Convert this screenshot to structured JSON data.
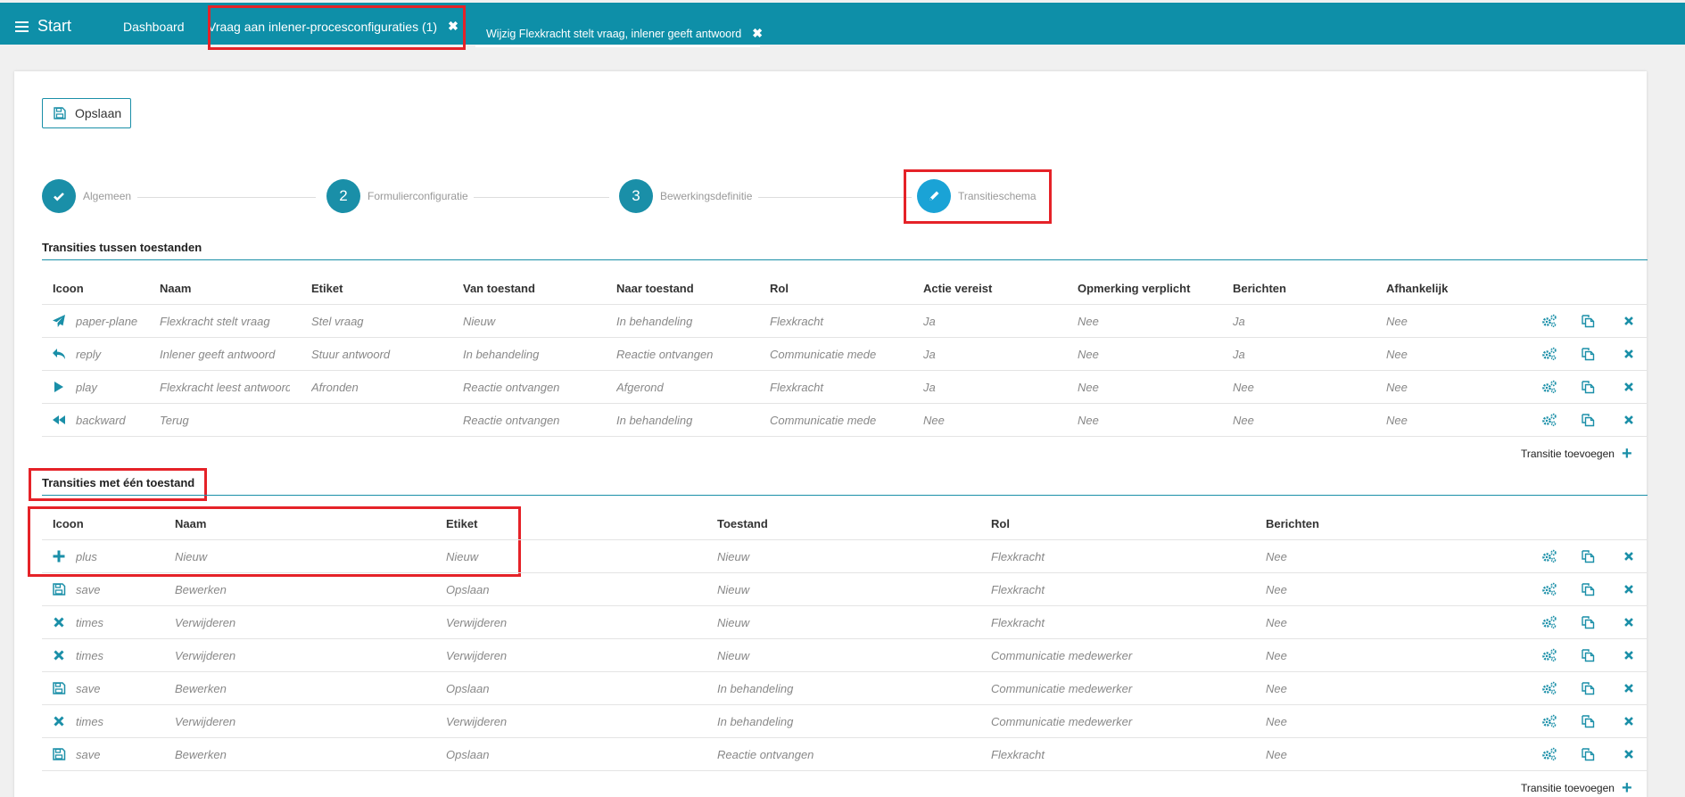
{
  "topbar": {
    "start": "Start",
    "dashboard": "Dashboard",
    "tabs": [
      {
        "label": "Vraag aan inlener-procesconfiguraties (1)"
      },
      {
        "label": "Wijzig Flexkracht stelt vraag, inlener geeft antwoord"
      }
    ]
  },
  "toolbar": {
    "save_label": "Opslaan"
  },
  "steps": [
    {
      "label": "Algemeen",
      "num": ""
    },
    {
      "label": "Formulierconfiguratie",
      "num": "2"
    },
    {
      "label": "Bewerkingsdefinitie",
      "num": "3"
    },
    {
      "label": "Transitieschema",
      "num": ""
    }
  ],
  "table1": {
    "title": "Transities tussen toestanden",
    "headers": [
      "Icoon",
      "Naam",
      "Etiket",
      "Van toestand",
      "Naar toestand",
      "Rol",
      "Actie vereist",
      "Opmerking verplicht",
      "Berichten",
      "Afhankelijk"
    ],
    "rows": [
      {
        "icon": "paper-plane",
        "naam": "Flexkracht stelt vraag",
        "etiket": "Stel vraag",
        "van": "Nieuw",
        "naar": "In behandeling",
        "rol": "Flexkracht",
        "actie": "Ja",
        "opmerking": "Nee",
        "berichten": "Ja",
        "afhankelijk": "Nee"
      },
      {
        "icon": "reply",
        "naam": "Inlener geeft antwoord",
        "etiket": "Stuur antwoord",
        "van": "In behandeling",
        "naar": "Reactie ontvangen",
        "rol": "Communicatie medewerker",
        "actie": "Ja",
        "opmerking": "Nee",
        "berichten": "Ja",
        "afhankelijk": "Nee"
      },
      {
        "icon": "play",
        "naam": "Flexkracht leest antwoord",
        "etiket": "Afronden",
        "van": "Reactie ontvangen",
        "naar": "Afgerond",
        "rol": "Flexkracht",
        "actie": "Ja",
        "opmerking": "Nee",
        "berichten": "Nee",
        "afhankelijk": "Nee"
      },
      {
        "icon": "backward",
        "naam": "Terug",
        "etiket": "",
        "van": "Reactie ontvangen",
        "naar": "In behandeling",
        "rol": "Communicatie medewerker",
        "actie": "Nee",
        "opmerking": "Nee",
        "berichten": "Nee",
        "afhankelijk": "Nee"
      }
    ],
    "add_label": "Transitie toevoegen"
  },
  "table2": {
    "title": "Transities met één toestand",
    "headers": [
      "Icoon",
      "Naam",
      "Etiket",
      "Toestand",
      "Rol",
      "Berichten"
    ],
    "rows": [
      {
        "icon": "plus",
        "naam": "Nieuw",
        "etiket": "Nieuw",
        "toestand": "Nieuw",
        "rol": "Flexkracht",
        "berichten": "Nee"
      },
      {
        "icon": "save",
        "naam": "Bewerken",
        "etiket": "Opslaan",
        "toestand": "Nieuw",
        "rol": "Flexkracht",
        "berichten": "Nee"
      },
      {
        "icon": "times",
        "naam": "Verwijderen",
        "etiket": "Verwijderen",
        "toestand": "Nieuw",
        "rol": "Flexkracht",
        "berichten": "Nee"
      },
      {
        "icon": "times",
        "naam": "Verwijderen",
        "etiket": "Verwijderen",
        "toestand": "Nieuw",
        "rol": "Communicatie medewerker",
        "berichten": "Nee"
      },
      {
        "icon": "save",
        "naam": "Bewerken",
        "etiket": "Opslaan",
        "toestand": "In behandeling",
        "rol": "Communicatie medewerker",
        "berichten": "Nee"
      },
      {
        "icon": "times",
        "naam": "Verwijderen",
        "etiket": "Verwijderen",
        "toestand": "In behandeling",
        "rol": "Communicatie medewerker",
        "berichten": "Nee"
      },
      {
        "icon": "save",
        "naam": "Bewerken",
        "etiket": "Opslaan",
        "toestand": "Reactie ontvangen",
        "rol": "Flexkracht",
        "berichten": "Nee"
      }
    ],
    "add_label": "Transitie toevoegen"
  },
  "colors": {
    "accent": "#0e8fa8",
    "highlight": "#e52228"
  }
}
